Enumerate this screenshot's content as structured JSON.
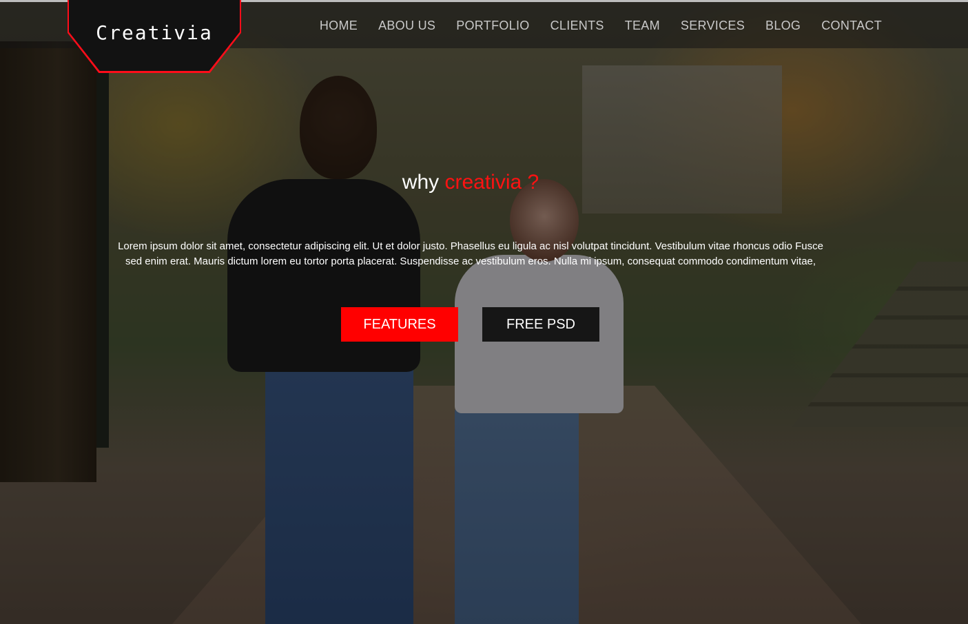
{
  "brand": {
    "logo_text": "Creativia",
    "accent_color": "#ff0000"
  },
  "nav": {
    "items": [
      {
        "label": "HOME"
      },
      {
        "label": "ABOU US"
      },
      {
        "label": "PORTFOLIO"
      },
      {
        "label": "CLIENTS"
      },
      {
        "label": "TEAM"
      },
      {
        "label": "SERVICES"
      },
      {
        "label": "BLOG"
      },
      {
        "label": "CONTACT"
      }
    ]
  },
  "hero": {
    "headline_prefix": "why",
    "headline_accent": "creativia ?",
    "paragraph": "Lorem ipsum dolor sit amet, consectetur adipiscing elit. Ut et dolor justo. Phasellus eu ligula ac nisl volutpat tincidunt. Vestibulum vitae rhoncus odio Fusce sed enim erat. Mauris dictum lorem eu tortor porta placerat. Suspendisse ac vestibulum eros. Nulla mi ipsum, consequat commodo condimentum vitae,",
    "buttons": {
      "features_label": "FEATURES",
      "free_psd_label": "FREE PSD"
    }
  }
}
